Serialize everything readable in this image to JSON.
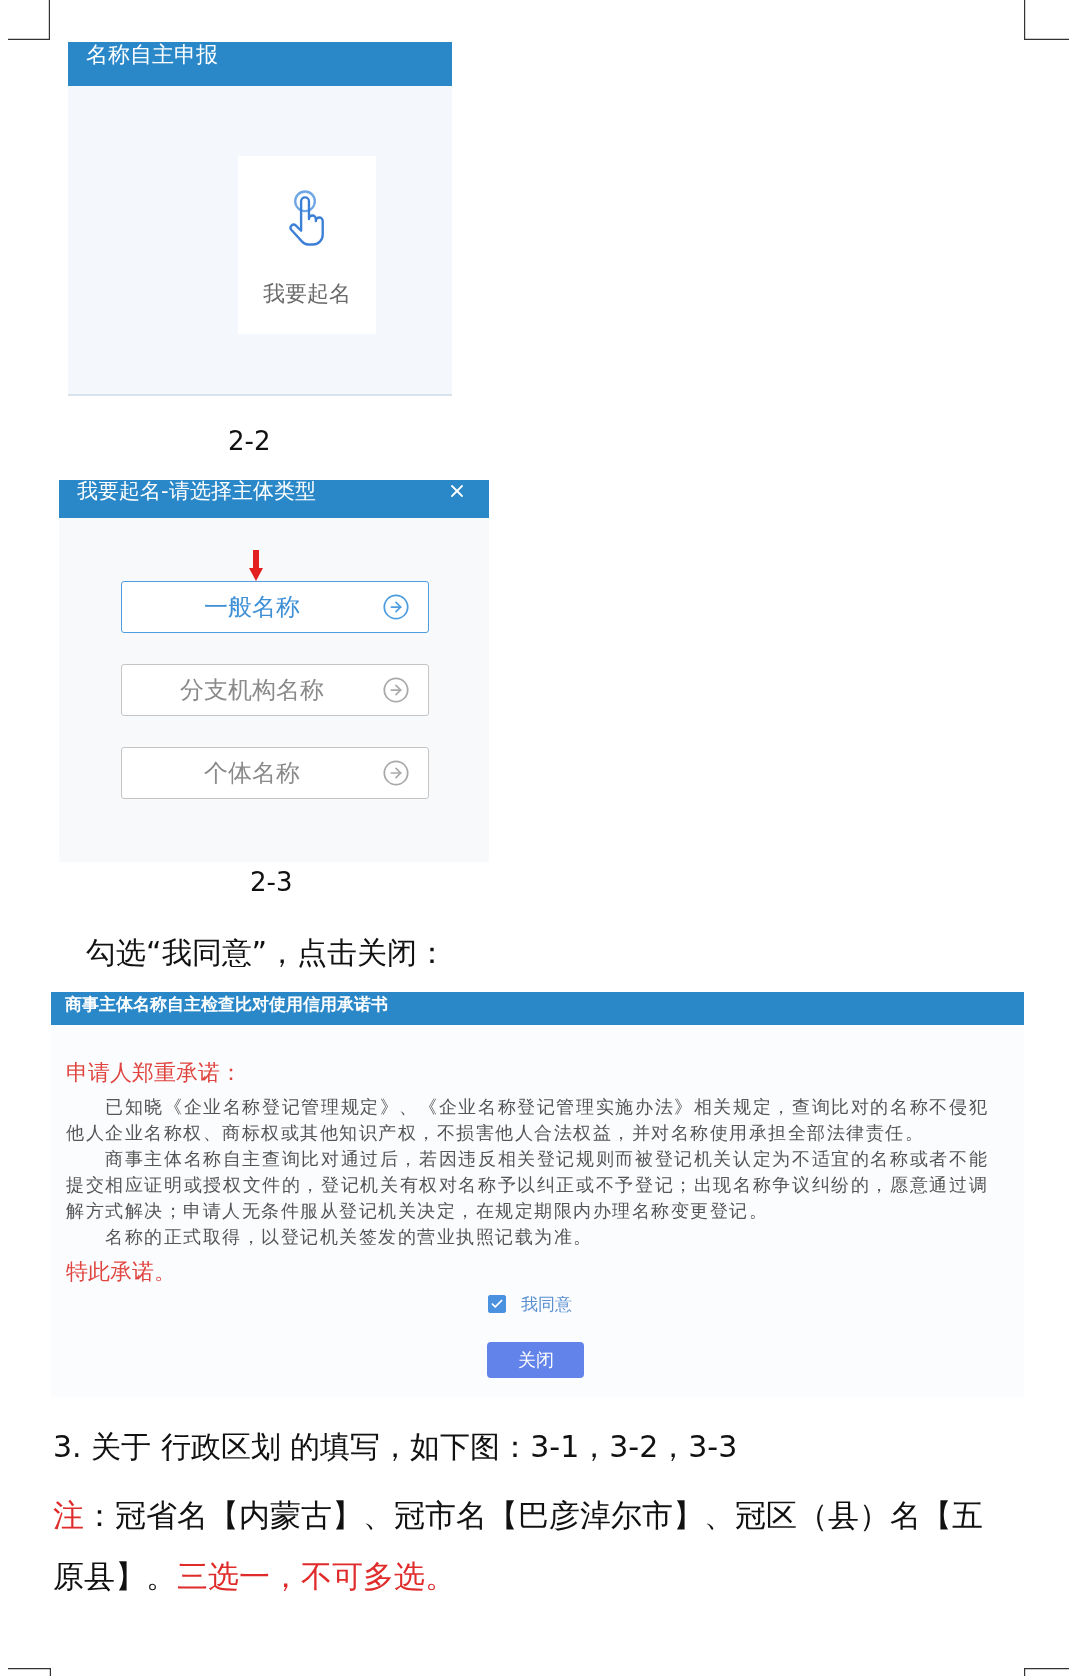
{
  "name_panel": {
    "title": "名称自主申报",
    "card_label": "我要起名"
  },
  "caption_1": "2-2",
  "type_dialog": {
    "title": "我要起名-请选择主体类型",
    "options": [
      {
        "label": "一般名称",
        "selected": true
      },
      {
        "label": "分支机构名称",
        "selected": false
      },
      {
        "label": "个体名称",
        "selected": false
      }
    ]
  },
  "caption_2": "2-3",
  "instruction": "勾选“我同意”，点击关闭：",
  "pledge_dialog": {
    "title": "商事主体名称自主检查比对使用信用承诺书",
    "heading": "申请人郑重承诺：",
    "paragraphs": [
      "已知晓《企业名称登记管理规定》、《企业名称登记管理实施办法》相关规定，查询比对的名称不侵犯他人企业名称权、商标权或其他知识产权，不损害他人合法权益，并对名称使用承担全部法律责任。",
      "商事主体名称自主查询比对通过后，若因违反相关登记规则而被登记机关认定为不适宜的名称或者不能提交相应证明或授权文件的，登记机关有权对名称予以纠正或不予登记；出现名称争议纠纷的，愿意通过调解方式解决；申请人无条件服从登记机关决定，在规定期限内办理名称变更登记。",
      "名称的正式取得，以登记机关签发的营业执照记载为准。"
    ],
    "closing": "特此承诺。",
    "agreement": {
      "label": "我同意",
      "checked": true
    },
    "close_button": "关闭"
  },
  "step_heading": "3. 关于 行政区划 的填写，如下图：3-1，3-2，3-3",
  "note": {
    "segments": [
      {
        "text": "注",
        "kind": "warning"
      },
      {
        "text": "：冠省名【内蒙古】、冠市名【巴彦淖尔市】、冠区（县）名【五原县】。",
        "kind": "plain"
      },
      {
        "text": "三选一，不可多选。",
        "kind": "warning"
      }
    ]
  }
}
